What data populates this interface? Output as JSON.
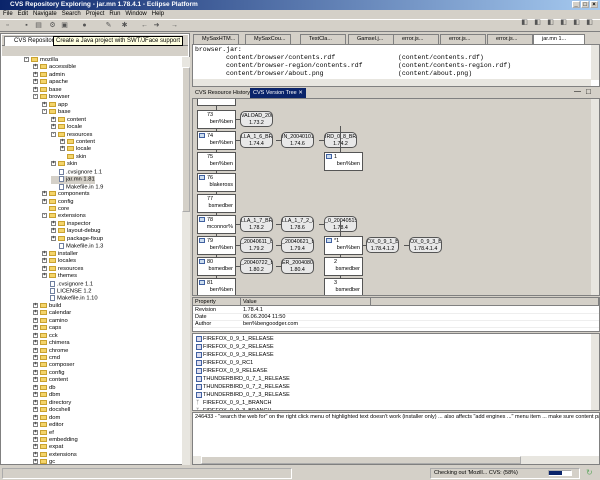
{
  "window": {
    "title": "CVS Repository Exploring - jar.mn 1.78.4.1 - Eclipse Platform"
  },
  "menu": [
    "File",
    "Edit",
    "Navigate",
    "Search",
    "Project",
    "Run",
    "Window",
    "Help"
  ],
  "left_view": {
    "tab": "CVS Repositories",
    "tooltip": "Create a Java project with SWT/JFace support",
    "tree": [
      {
        "l": 0,
        "t": "d",
        "e": "-",
        "n": "mozilla"
      },
      {
        "l": 1,
        "t": "d",
        "e": "+",
        "n": "accessible"
      },
      {
        "l": 1,
        "t": "d",
        "e": "+",
        "n": "admin"
      },
      {
        "l": 1,
        "t": "d",
        "e": "+",
        "n": "apache"
      },
      {
        "l": 1,
        "t": "d",
        "e": "+",
        "n": "base"
      },
      {
        "l": 1,
        "t": "d",
        "e": "-",
        "n": "browser"
      },
      {
        "l": 2,
        "t": "d",
        "e": "+",
        "n": "app"
      },
      {
        "l": 2,
        "t": "d",
        "e": "-",
        "n": "base"
      },
      {
        "l": 3,
        "t": "d",
        "e": "+",
        "n": "content"
      },
      {
        "l": 3,
        "t": "d",
        "e": "+",
        "n": "locale"
      },
      {
        "l": 3,
        "t": "d",
        "e": "-",
        "n": "resources"
      },
      {
        "l": 4,
        "t": "d",
        "e": "+",
        "n": "content"
      },
      {
        "l": 4,
        "t": "d",
        "e": "+",
        "n": "locale"
      },
      {
        "l": 4,
        "t": "d",
        "e": "",
        "n": "skin"
      },
      {
        "l": 3,
        "t": "d",
        "e": "+",
        "n": "skin"
      },
      {
        "l": 3,
        "t": "f",
        "n": ".cvsignore 1.1"
      },
      {
        "l": 3,
        "t": "f",
        "n": "jar.mn 1.81",
        "sel": true
      },
      {
        "l": 3,
        "t": "f",
        "n": "Makefile.in 1.9"
      },
      {
        "l": 2,
        "t": "d",
        "e": "+",
        "n": "components"
      },
      {
        "l": 2,
        "t": "d",
        "e": "+",
        "n": "config"
      },
      {
        "l": 2,
        "t": "d",
        "e": "",
        "n": "core"
      },
      {
        "l": 2,
        "t": "d",
        "e": "-",
        "n": "extensions"
      },
      {
        "l": 3,
        "t": "d",
        "e": "+",
        "n": "inspector"
      },
      {
        "l": 3,
        "t": "d",
        "e": "+",
        "n": "layout-debug"
      },
      {
        "l": 3,
        "t": "d",
        "e": "+",
        "n": "package-fixup"
      },
      {
        "l": 3,
        "t": "f",
        "n": "Makefile.in 1.3"
      },
      {
        "l": 2,
        "t": "d",
        "e": "+",
        "n": "installer"
      },
      {
        "l": 2,
        "t": "d",
        "e": "+",
        "n": "locales"
      },
      {
        "l": 2,
        "t": "d",
        "e": "+",
        "n": "resources"
      },
      {
        "l": 2,
        "t": "d",
        "e": "+",
        "n": "themes"
      },
      {
        "l": 2,
        "t": "f",
        "n": ".cvsignore 1.1"
      },
      {
        "l": 2,
        "t": "f",
        "n": "LICENSE 1.2"
      },
      {
        "l": 2,
        "t": "f",
        "n": "Makefile.in 1.10"
      },
      {
        "l": 1,
        "t": "d",
        "e": "+",
        "n": "build"
      },
      {
        "l": 1,
        "t": "d",
        "e": "+",
        "n": "calendar"
      },
      {
        "l": 1,
        "t": "d",
        "e": "+",
        "n": "camino"
      },
      {
        "l": 1,
        "t": "d",
        "e": "+",
        "n": "caps"
      },
      {
        "l": 1,
        "t": "d",
        "e": "+",
        "n": "cck"
      },
      {
        "l": 1,
        "t": "d",
        "e": "+",
        "n": "chimera"
      },
      {
        "l": 1,
        "t": "d",
        "e": "+",
        "n": "chrome"
      },
      {
        "l": 1,
        "t": "d",
        "e": "+",
        "n": "cmd"
      },
      {
        "l": 1,
        "t": "d",
        "e": "+",
        "n": "composer"
      },
      {
        "l": 1,
        "t": "d",
        "e": "+",
        "n": "config"
      },
      {
        "l": 1,
        "t": "d",
        "e": "+",
        "n": "content"
      },
      {
        "l": 1,
        "t": "d",
        "e": "+",
        "n": "db"
      },
      {
        "l": 1,
        "t": "d",
        "e": "+",
        "n": "dbm"
      },
      {
        "l": 1,
        "t": "d",
        "e": "+",
        "n": "directory"
      },
      {
        "l": 1,
        "t": "d",
        "e": "+",
        "n": "docshell"
      },
      {
        "l": 1,
        "t": "d",
        "e": "+",
        "n": "dom"
      },
      {
        "l": 1,
        "t": "d",
        "e": "+",
        "n": "editor"
      },
      {
        "l": 1,
        "t": "d",
        "e": "+",
        "n": "ef"
      },
      {
        "l": 1,
        "t": "d",
        "e": "+",
        "n": "embedding"
      },
      {
        "l": 1,
        "t": "d",
        "e": "+",
        "n": "expat"
      },
      {
        "l": 1,
        "t": "d",
        "e": "+",
        "n": "extensions"
      },
      {
        "l": 1,
        "t": "d",
        "e": "+",
        "n": "gc"
      }
    ]
  },
  "editor": {
    "tabs": [
      "MySaxHTM...",
      "MySaxCou...",
      "TestCla...",
      "Gamsel.j...",
      "error.js...",
      "error.js...",
      "error.js...",
      "jar.mn 1..."
    ],
    "lines": [
      [
        "browser.jar:",
        ""
      ],
      [
        "content/browser/contents.rdf",
        "(content/contents.rdf)"
      ],
      [
        "content/browser-region/contents.rdf",
        "(content/contents-region.rdf)"
      ],
      [
        "content/browser/about.png",
        "(content/about.png)"
      ]
    ]
  },
  "views": {
    "tabs": [
      "CVS Resource History",
      "CVS Version Tree"
    ]
  },
  "version_tree": {
    "revisions": [
      {
        "n": "",
        "a": ""
      },
      {
        "n": "73",
        "a": "ben%ben"
      },
      {
        "n": "74",
        "a": "ben%ben"
      },
      {
        "n": "75",
        "a": "ben%ben"
      },
      {
        "n": "76",
        "a": "blakeross"
      },
      {
        "n": "77",
        "a": "bsmedber"
      },
      {
        "n": "78",
        "a": "mconnor%"
      },
      {
        "n": "79",
        "a": "ben%ben"
      },
      {
        "n": "80",
        "a": "bsmedber"
      },
      {
        "n": "81",
        "a": "ben%ben"
      }
    ],
    "branch_revisions": [
      {
        "n": "1",
        "a": "ben%ben"
      },
      {
        "n": "*1",
        "a": "ben%ben"
      },
      {
        "n": "2",
        "a": "bsmedber"
      },
      {
        "n": "3",
        "a": "bsmedber"
      }
    ],
    "tags": [
      {
        "n": "VALOAD_2003",
        "r": "1.73.2"
      },
      {
        "n": "LLA_1_6_BRA",
        "r": "1.74.4"
      },
      {
        "n": "IN_20040101",
        "r": "1.74.6"
      },
      {
        "n": "IRD_0_8_BRA",
        "r": "1.74.2"
      },
      {
        "n": "LLA_1_7_BRA",
        "r": "1.78.2"
      },
      {
        "n": "LLA_1_7_2_BR",
        "r": "1.78.6"
      },
      {
        "n": "_0_20040515",
        "r": "1.78.4"
      },
      {
        "n": "_20040611_BI",
        "r": "1.79.2"
      },
      {
        "n": "_20040621_BI",
        "r": "1.79.4"
      },
      {
        "n": "OX_0_9_1_BR",
        "r": "1.78.4.1.2"
      },
      {
        "n": "OX_0_9_3_BR",
        "r": "1.78.4.1.4"
      },
      {
        "n": "_20040722_BI",
        "r": "1.80.2"
      },
      {
        "n": "ER_20040804",
        "r": "1.80.4"
      }
    ]
  },
  "properties": {
    "headers": [
      "Property",
      "Value"
    ],
    "rows": [
      [
        "Revision",
        "1.78.4.1"
      ],
      [
        "Date",
        "06.06.2004 11:50"
      ],
      [
        "Author",
        "ben%bengoodger.com"
      ]
    ]
  },
  "tag_list": [
    {
      "i": "v",
      "n": "FIREFOX_0_9_1_RELEASE"
    },
    {
      "i": "v",
      "n": "FIREFOX_0_9_2_RELEASE"
    },
    {
      "i": "v",
      "n": "FIREFOX_0_9_3_RELEASE"
    },
    {
      "i": "v",
      "n": "FIREFOX_0_9_RC1"
    },
    {
      "i": "v",
      "n": "FIREFOX_0_9_RELEASE"
    },
    {
      "i": "v",
      "n": "THUNDERBIRD_0_7_1_RELEASE"
    },
    {
      "i": "v",
      "n": "THUNDERBIRD_0_7_2_RELEASE"
    },
    {
      "i": "v",
      "n": "THUNDERBIRD_0_7_3_RELEASE"
    },
    {
      "i": "b",
      "n": "FIREFOX_0_9_1_BRANCH"
    },
    {
      "i": "b",
      "n": "FIREFOX_0_9_3_BRANCH"
    }
  ],
  "comment": "246433 - \"search the web for\" on the right click menu of highlighted text doesn't work (installer only) ... also affects \"add engines ...\" menu item ... make sure content package",
  "status": {
    "text": "Checking out 'Mozill... CVS: (58%)",
    "progress": 58
  }
}
